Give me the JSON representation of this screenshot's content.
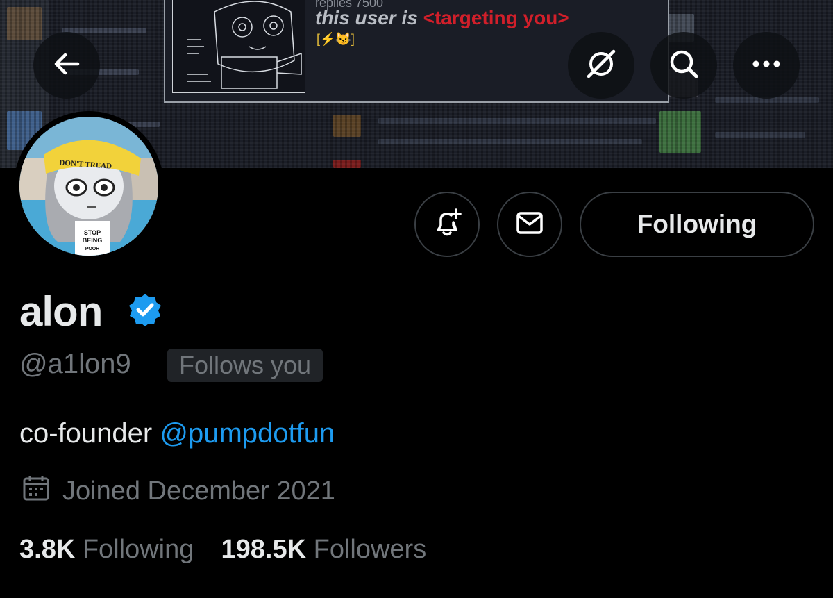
{
  "banner": {
    "card_meta": "replies 7500",
    "card_text_prefix": "this user is",
    "card_text_red": "<targeting you>",
    "card_sub": "[⚡😼]"
  },
  "header": {
    "back_icon": "arrow-left-icon",
    "grok_icon": "slashed-circle-icon",
    "search_icon": "search-icon",
    "more_icon": "ellipsis-icon"
  },
  "avatar": {
    "hat_text": "DON'T TREAD",
    "shirt_text": [
      "STOP",
      "BEING",
      "POOR"
    ]
  },
  "actions": {
    "notify_icon": "bell-plus-icon",
    "message_icon": "mail-icon",
    "follow_label": "Following"
  },
  "profile": {
    "name": "alon",
    "verified": true,
    "handle": "@a1lon9",
    "follows_you": "Follows you",
    "bio_text": "co-founder ",
    "bio_mention": "@pumpdotfun",
    "joined": "Joined December 2021",
    "following_count": "3.8K",
    "following_label": "Following",
    "followers_count": "198.5K",
    "followers_label": "Followers"
  },
  "colors": {
    "background": "#000000",
    "text_primary": "#e7e9ea",
    "text_secondary": "#71767b",
    "link": "#1d9bf0",
    "verified": "#1d9bf0",
    "banner_red": "#d11f2a"
  }
}
